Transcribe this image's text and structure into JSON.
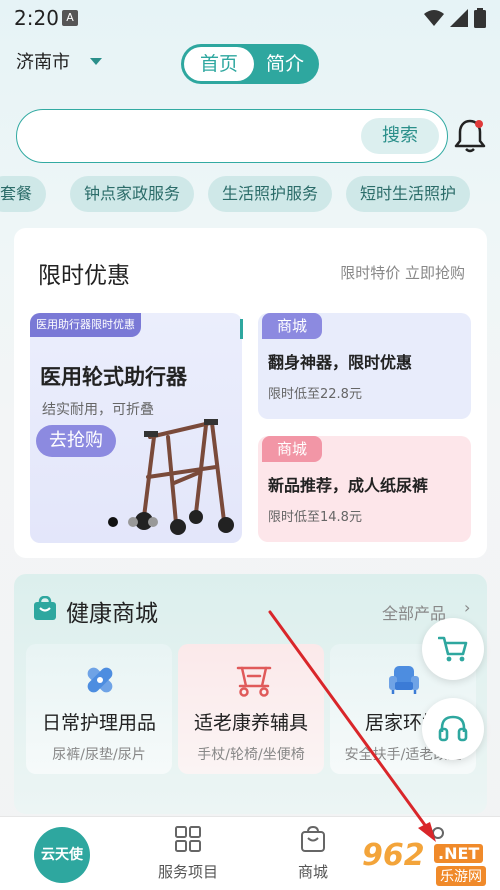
{
  "status": {
    "time": "2:20",
    "notif_letter": "A"
  },
  "header": {
    "city": "济南市",
    "toggle_home": "首页",
    "toggle_intro": "简介"
  },
  "search": {
    "button": "搜索",
    "placeholder": ""
  },
  "chips": [
    "套餐",
    "钟点家政服务",
    "生活照护服务",
    "短时生活照护"
  ],
  "promo": {
    "title": "限时优惠",
    "more": "限时特价 立即抢购",
    "banner": {
      "tag": "医用助行器限时优惠",
      "title": "医用轮式助行器",
      "subtitle": "结实耐用，可折叠",
      "button": "去抢购"
    },
    "cards": [
      {
        "tag": "商城",
        "title": "翻身神器，限时优惠",
        "subtitle": "限时低至22.8元"
      },
      {
        "tag": "商城",
        "title": "新品推荐，成人纸尿裤",
        "subtitle": "限时低至14.8元"
      }
    ]
  },
  "shop": {
    "title": "健康商城",
    "more": "全部产品",
    "more_arrow": "›",
    "categories": [
      {
        "title": "日常护理用品",
        "subtitle": "尿裤/尿垫/尿片",
        "icon": "bandage-icon"
      },
      {
        "title": "适老康养辅具",
        "subtitle": "手杖/轮椅/坐便椅",
        "icon": "walker-icon"
      },
      {
        "title": "居家环境",
        "subtitle": "安全扶手/适老改造",
        "icon": "armchair-icon"
      }
    ]
  },
  "tabbar": {
    "main": "云天使",
    "services": "服务项目",
    "mall": "商城"
  },
  "watermark": {
    "logo": "962",
    "net": ".NET",
    "text": "乐游网"
  },
  "colors": {
    "primary": "#2ea79f",
    "purple": "#8c8ae0",
    "pink": "#f296a6",
    "arrow": "#d9262a"
  }
}
